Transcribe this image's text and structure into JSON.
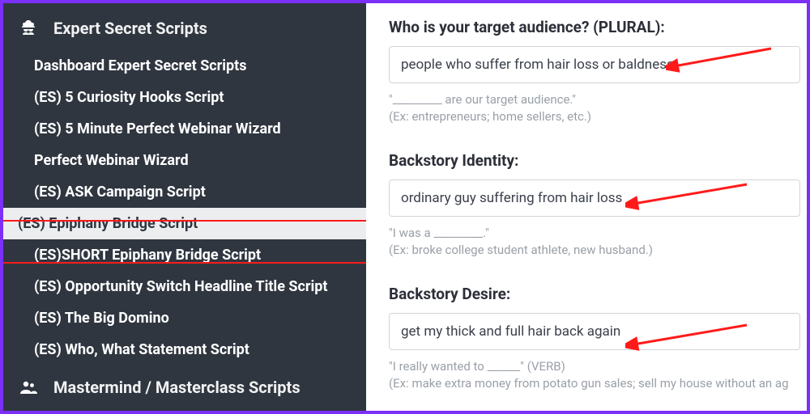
{
  "sidebar": {
    "title": "Expert Secret Scripts",
    "items": [
      {
        "label": "Dashboard Expert Secret Scripts"
      },
      {
        "label": "(ES) 5 Curiosity Hooks Script"
      },
      {
        "label": "(ES) 5 Minute Perfect Webinar Wizard"
      },
      {
        "label": "Perfect Webinar Wizard"
      },
      {
        "label": "(ES) ASK Campaign Script"
      },
      {
        "label": "(ES) Epiphany Bridge Script"
      },
      {
        "label": "(ES)SHORT Epiphany Bridge Script"
      },
      {
        "label": "(ES) Opportunity Switch Headline Title Script"
      },
      {
        "label": "(ES) The Big Domino"
      },
      {
        "label": "(ES) Who, What Statement Script"
      }
    ],
    "footer": "Mastermind / Masterclass Scripts"
  },
  "form": {
    "field1": {
      "label": "Who is your target audience? (PLURAL):",
      "value": "people who suffer from hair loss or baldness",
      "hint1": "\"_________ are our target audience.\"",
      "hint2": "(Ex: entrepreneurs; home sellers, etc.)"
    },
    "field2": {
      "label": "Backstory Identity:",
      "value": "ordinary guy suffering from hair loss",
      "hint1": "\"I was a _________.\"",
      "hint2": "(Ex: broke college student athlete, new husband.)"
    },
    "field3": {
      "label": "Backstory Desire:",
      "value": "get my thick and full hair back again",
      "hint1": "\"I really wanted to ______\" (VERB)",
      "hint2": "(Ex: make extra money from potato gun sales; sell my house without an ag"
    }
  }
}
